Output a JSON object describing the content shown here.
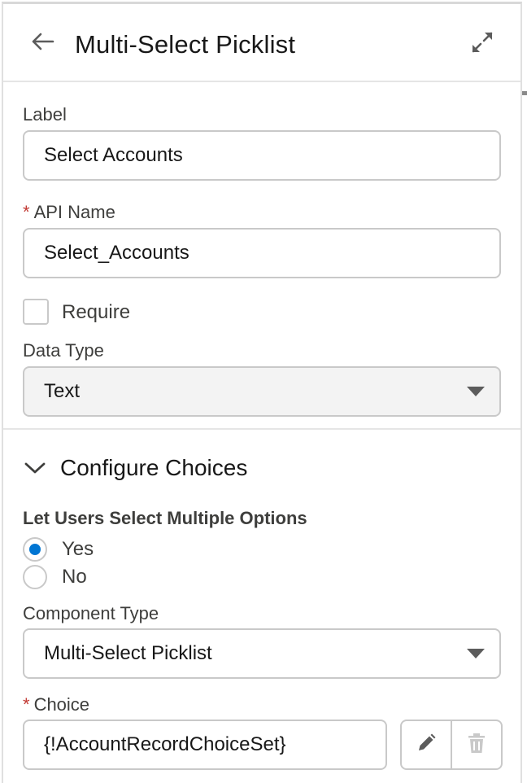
{
  "header": {
    "title": "Multi-Select Picklist",
    "back_icon": "arrow-left-icon",
    "expand_icon": "expand-icon"
  },
  "fields": {
    "label": {
      "label": "Label",
      "value": "Select Accounts"
    },
    "api_name": {
      "required_marker": "*",
      "label": "API Name",
      "value": "Select_Accounts"
    },
    "require": {
      "label": "Require",
      "checked": false
    },
    "data_type": {
      "label": "Data Type",
      "value": "Text",
      "disabled": true
    }
  },
  "configure_choices": {
    "title": "Configure Choices",
    "expanded": true,
    "multi_select": {
      "label": "Let Users Select Multiple Options",
      "options": [
        {
          "label": "Yes",
          "checked": true
        },
        {
          "label": "No",
          "checked": false
        }
      ]
    },
    "component_type": {
      "label": "Component Type",
      "value": "Multi-Select Picklist"
    },
    "choice": {
      "required_marker": "*",
      "label": "Choice",
      "value": "{!AccountRecordChoiceSet}",
      "edit_icon": "pencil-icon",
      "delete_icon": "trash-icon"
    }
  },
  "colors": {
    "accent": "#0176d3",
    "required": "#c23934",
    "border": "#c9c9c9",
    "disabled_bg": "#f3f3f3"
  }
}
